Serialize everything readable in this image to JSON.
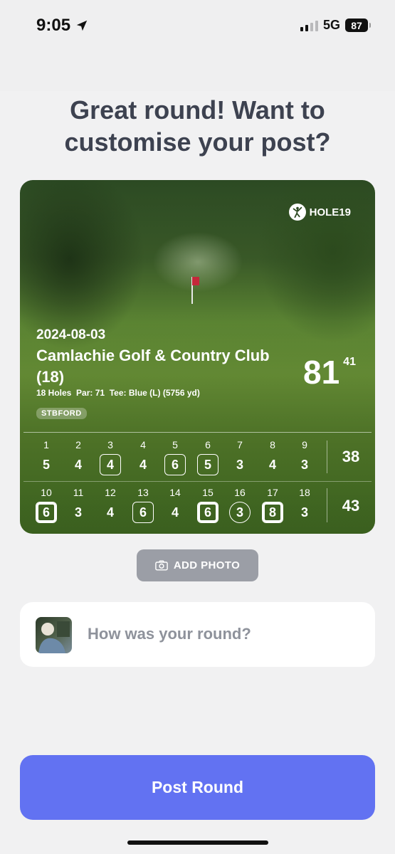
{
  "status_bar": {
    "time": "9:05",
    "network": "5G",
    "battery": "87"
  },
  "headline": "Great round! Want to customise your post?",
  "card": {
    "brand": "HOLE19",
    "date": "2024-08-03",
    "course": "Camlachie Golf & Country Club (18)",
    "details": "18 Holes  Par: 71  Tee: Blue (L) (5756 yd)",
    "format_badge": "STBFORD",
    "total_score": "81",
    "total_points": "41",
    "front_nine": {
      "holes": [
        {
          "num": "1",
          "score": "5",
          "mark": "none"
        },
        {
          "num": "2",
          "score": "4",
          "mark": "none"
        },
        {
          "num": "3",
          "score": "4",
          "mark": "bogey"
        },
        {
          "num": "4",
          "score": "4",
          "mark": "none"
        },
        {
          "num": "5",
          "score": "6",
          "mark": "bogey"
        },
        {
          "num": "6",
          "score": "5",
          "mark": "bogey"
        },
        {
          "num": "7",
          "score": "3",
          "mark": "none"
        },
        {
          "num": "8",
          "score": "4",
          "mark": "none"
        },
        {
          "num": "9",
          "score": "3",
          "mark": "none"
        }
      ],
      "total": "38"
    },
    "back_nine": {
      "holes": [
        {
          "num": "10",
          "score": "6",
          "mark": "double"
        },
        {
          "num": "11",
          "score": "3",
          "mark": "none"
        },
        {
          "num": "12",
          "score": "4",
          "mark": "none"
        },
        {
          "num": "13",
          "score": "6",
          "mark": "bogey"
        },
        {
          "num": "14",
          "score": "4",
          "mark": "none"
        },
        {
          "num": "15",
          "score": "6",
          "mark": "double"
        },
        {
          "num": "16",
          "score": "3",
          "mark": "birdie"
        },
        {
          "num": "17",
          "score": "8",
          "mark": "double"
        },
        {
          "num": "18",
          "score": "3",
          "mark": "none"
        }
      ],
      "total": "43"
    }
  },
  "add_photo_label": "ADD PHOTO",
  "comment": {
    "placeholder": "How was your round?"
  },
  "post_button": "Post Round"
}
